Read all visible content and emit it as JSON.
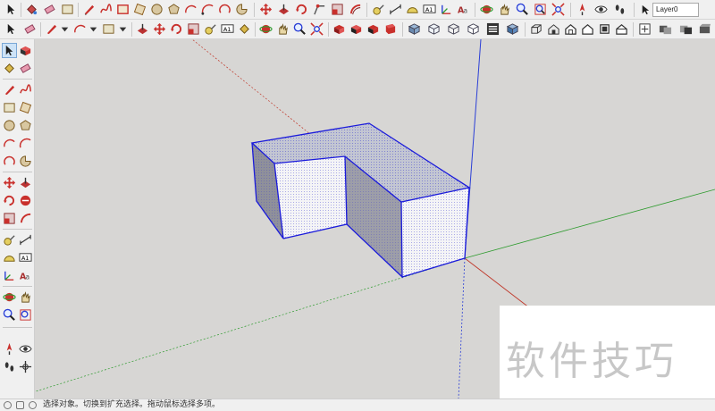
{
  "toolbar": {
    "layer": {
      "selected": "Layer0"
    },
    "row1_icons": [
      "select-arrow-icon",
      "eraser-icon",
      "paint-bucket-icon",
      "eraser-pink-icon",
      "rectangle-icon",
      "pencil-icon",
      "freehand-icon",
      "rectangle-red-icon",
      "rotated-rectangle-icon",
      "circle-icon",
      "polygon-icon",
      "arc-icon",
      "arc-two-point-icon",
      "arc-three-point-icon",
      "pie-icon",
      "move-icon",
      "push-pull-icon",
      "rotate-icon",
      "follow-me-icon",
      "scale-icon",
      "offset-icon",
      "tape-measure-icon",
      "text-icon",
      "protractor-icon",
      "axes-icon",
      "dimension-icon",
      "3d-text-icon",
      "orbit-icon",
      "pan-icon",
      "zoom-icon",
      "zoom-window-icon",
      "zoom-extents-icon",
      "position-camera-icon",
      "look-around-icon",
      "walk-icon",
      "layer-dropdown-icon"
    ],
    "row2_icons": [
      "select-arrow-icon",
      "eraser-icon",
      "pencil-icon",
      "dropdown-icon",
      "arc-icon",
      "dropdown-icon",
      "push-pull-icon",
      "move-icon",
      "rotate-icon",
      "scale-icon",
      "tape-measure-icon",
      "text-icon",
      "paint-bucket-icon",
      "orbit-icon",
      "pan-icon",
      "zoom-icon",
      "zoom-extents-icon",
      "component-icon",
      "group-icon",
      "warehouse-icon",
      "xray-icon",
      "back-edges-icon",
      "wireframe-icon",
      "hidden-line-icon",
      "shaded-icon",
      "shaded-textures-icon",
      "iso-view-icon",
      "top-view-icon",
      "front-view-icon",
      "right-view-icon",
      "back-view-icon",
      "left-view-icon",
      "section-plane-icon",
      "section-display-icon"
    ],
    "left_icons": [
      "select-arrow-icon",
      "component-icon",
      "paint-bucket-icon",
      "eraser-icon",
      "pencil-icon",
      "freehand-icon",
      "rectangle-icon",
      "rotated-rectangle-icon",
      "circle-icon",
      "polygon-icon",
      "arc-icon",
      "arc-two-point-icon",
      "arc-three-point-icon",
      "pie-icon",
      "move-icon",
      "push-pull-icon",
      "rotate-icon",
      "follow-me-icon",
      "scale-icon",
      "offset-icon",
      "tape-measure-icon",
      "dimension-icon",
      "protractor-icon",
      "text-icon",
      "axes-icon",
      "3d-text-icon",
      "orbit-icon",
      "pan-icon",
      "zoom-icon",
      "zoom-window-icon",
      "position-camera-icon",
      "look-around-icon",
      "walk-icon",
      "section-plane-icon"
    ]
  },
  "viewport": {
    "axis_colors": {
      "red": "#c0392b",
      "green": "#2e9b2e",
      "blue": "#2b3fd6"
    },
    "selection_color": "#1a1adb"
  },
  "watermark": {
    "text": "软件技巧"
  },
  "status": {
    "message": "选择对象。切换到扩充选择。拖动鼠标选择多项。"
  }
}
